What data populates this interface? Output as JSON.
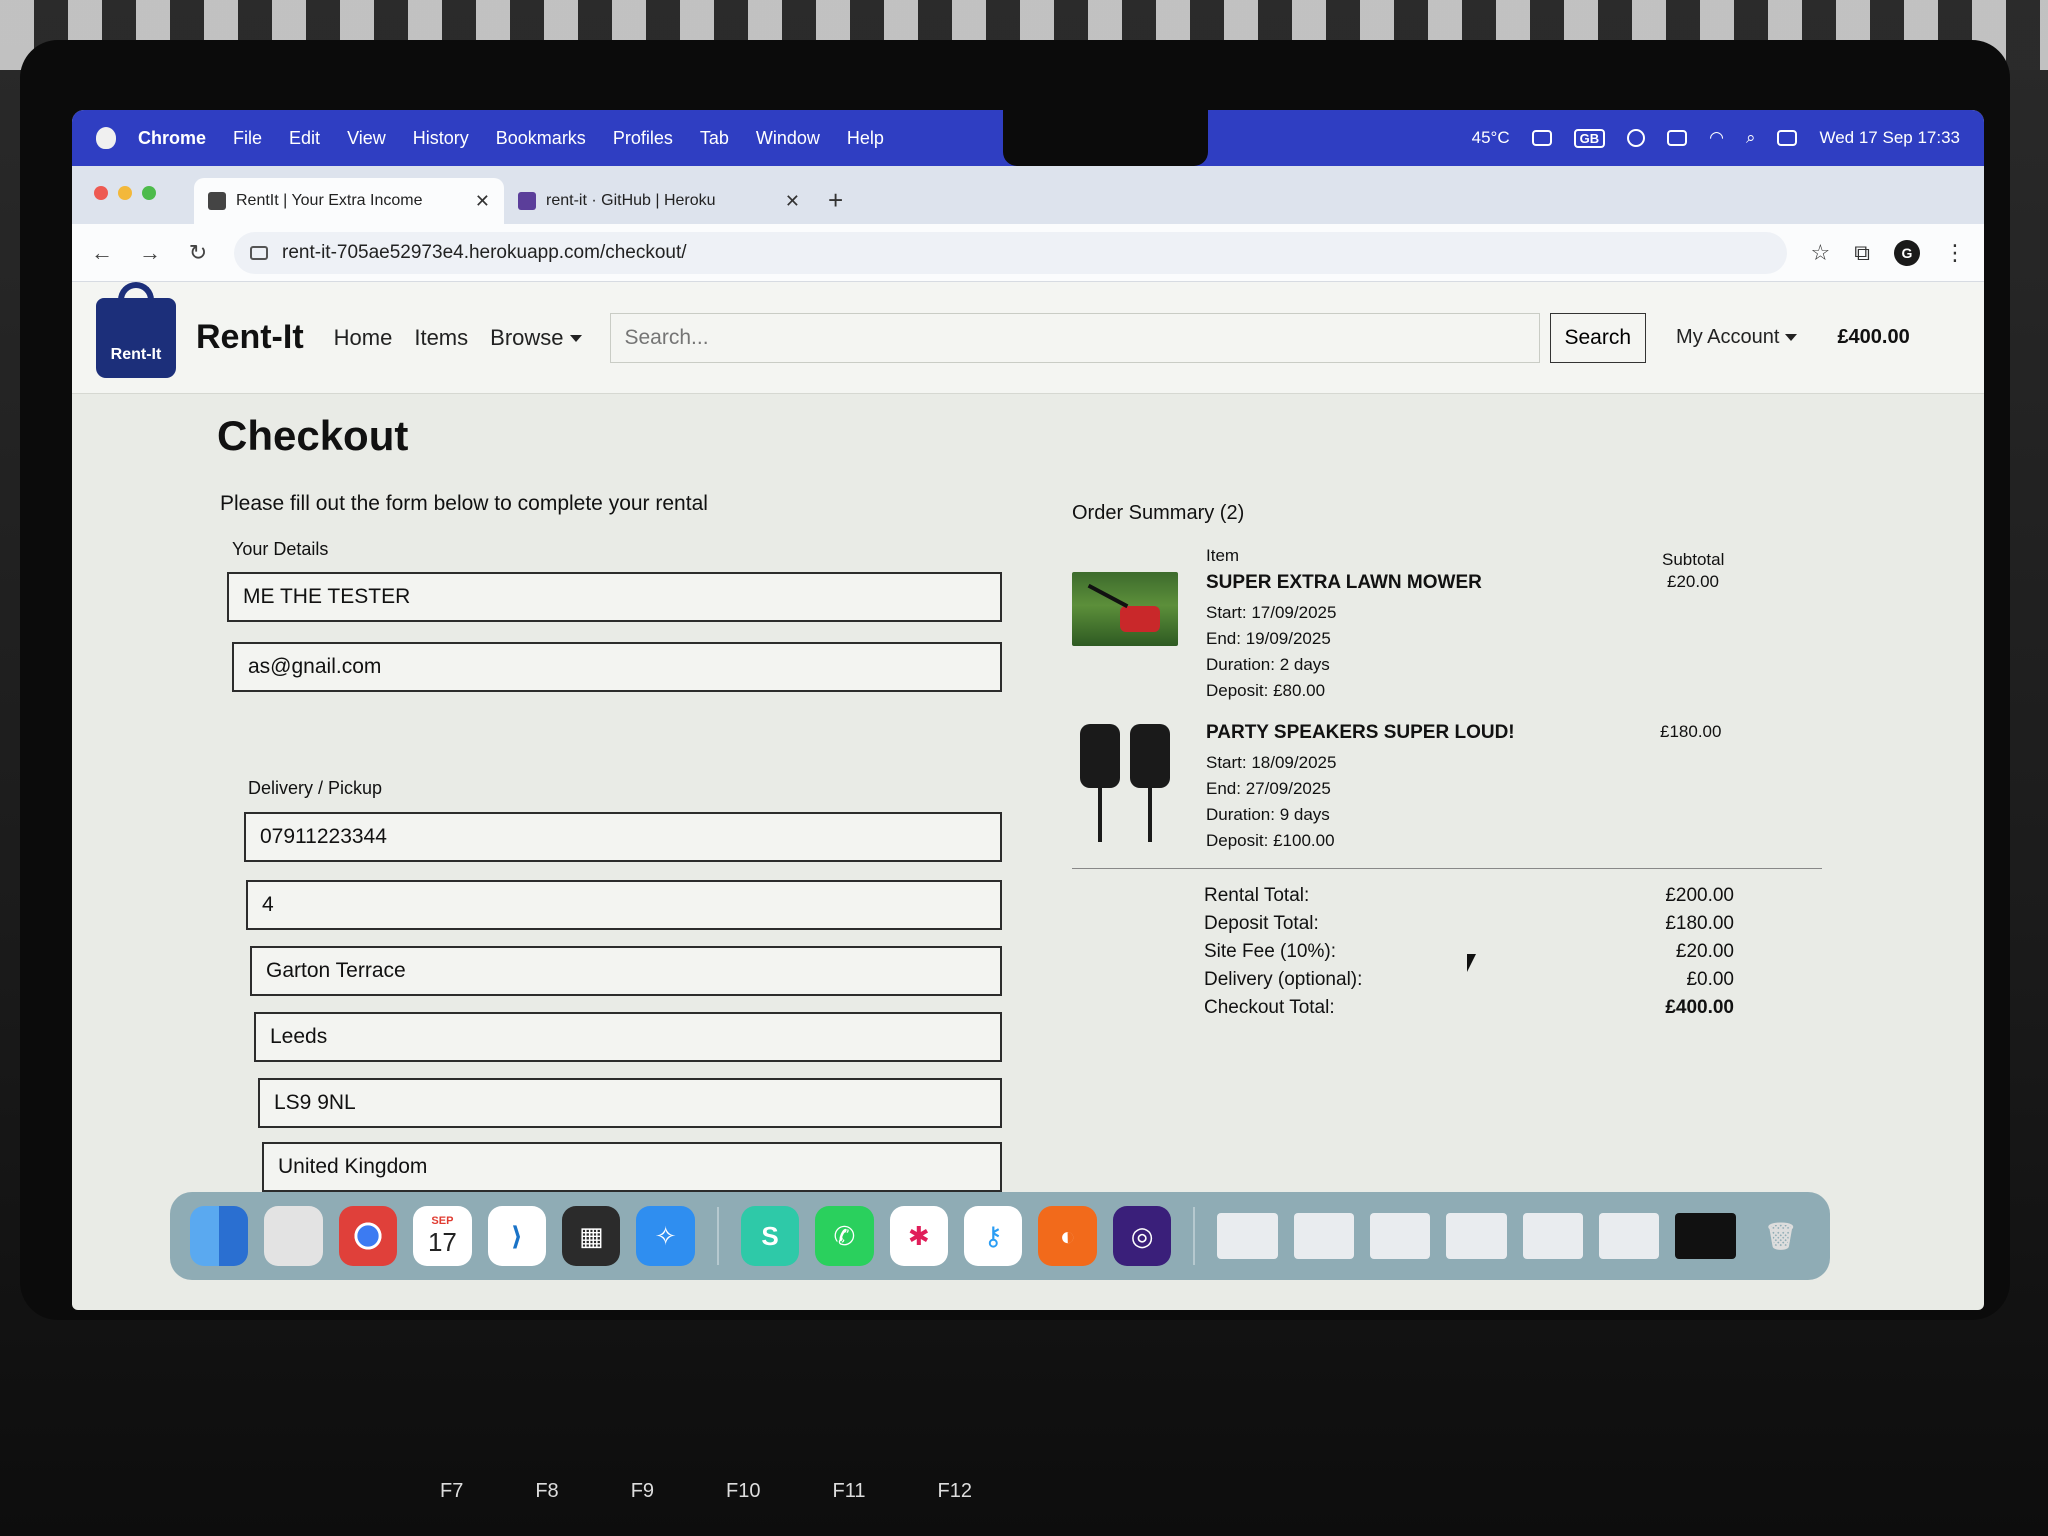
{
  "menubar": {
    "app": "Chrome",
    "items": [
      "File",
      "Edit",
      "View",
      "History",
      "Bookmarks",
      "Profiles",
      "Tab",
      "Window",
      "Help"
    ],
    "temperature": "45°C",
    "keyboard": "GB",
    "datetime": "Wed 17 Sep  17:33"
  },
  "browser": {
    "tabs": [
      {
        "title": "RentIt | Your Extra Income",
        "icon": "bag-icon"
      },
      {
        "title": "rent-it · GitHub | Heroku",
        "icon": "heroku-icon"
      }
    ],
    "url": "rent-it-705ae52973e4.herokuapp.com/checkout/",
    "profile_initial": "G"
  },
  "site": {
    "logo_text": "Rent-It",
    "brand": "Rent-It",
    "nav": [
      "Home",
      "Items",
      "Browse"
    ],
    "search_placeholder": "Search...",
    "search_button": "Search",
    "account": "My Account",
    "basket_total": "£400.00"
  },
  "checkout": {
    "title": "Checkout",
    "intro": "Please fill out the form below to complete your rental",
    "details_label": "Your Details",
    "name": "ME THE TESTER",
    "email": "as@gnail.com",
    "delivery_label": "Delivery / Pickup",
    "phone": "07911223344",
    "house": "4",
    "street": "Garton Terrace",
    "city": "Leeds",
    "postcode": "LS9 9NL",
    "country": "United Kingdom"
  },
  "summary": {
    "title": "Order Summary (2)",
    "col_item": "Item",
    "col_subtotal": "Subtotal",
    "items": [
      {
        "name": "SUPER EXTRA LAWN MOWER",
        "start": "Start: 17/09/2025",
        "end": "End: 19/09/2025",
        "duration": "Duration: 2 days",
        "deposit": "Deposit: £80.00",
        "subtotal": "£20.00"
      },
      {
        "name": "PARTY SPEAKERS SUPER LOUD!",
        "start": "Start: 18/09/2025",
        "end": "End: 27/09/2025",
        "duration": "Duration: 9 days",
        "deposit": "Deposit: £100.00",
        "subtotal": "£180.00"
      }
    ],
    "totals": [
      {
        "label": "Rental Total:",
        "value": "£200.00"
      },
      {
        "label": "Deposit Total:",
        "value": "£180.00"
      },
      {
        "label": "Site Fee (10%):",
        "value": "£20.00"
      },
      {
        "label": "Delivery (optional):",
        "value": "£0.00"
      },
      {
        "label": "Checkout Total:",
        "value": "£400.00"
      }
    ]
  },
  "dock": {
    "calendar_month": "SEP",
    "calendar_day": "17"
  },
  "keyboard_keys": [
    "F7",
    "F8",
    "F9",
    "F10",
    "F11",
    "F12"
  ]
}
